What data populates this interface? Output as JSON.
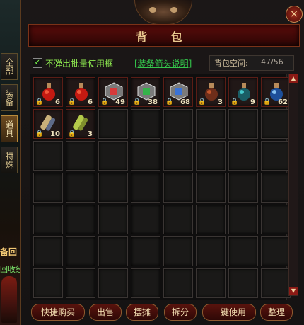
{
  "window": {
    "title": "背  包",
    "close_label": "×",
    "tabs": [
      {
        "label": "全部",
        "active": false
      },
      {
        "label": "装备",
        "active": false
      },
      {
        "label": "道具",
        "active": true
      },
      {
        "label": "特殊",
        "active": false
      }
    ]
  },
  "toolbar": {
    "checkbox_checked": true,
    "checkbox_mark": "✓",
    "checkbox_label": "不弹出批量使用框",
    "help_link": "[装备箭头说明]",
    "capacity_label": "背包空间:",
    "capacity_value": "47/56"
  },
  "inventory": {
    "items": [
      {
        "name": "red-potion-flask-icon",
        "qty": "6",
        "locked": true
      },
      {
        "name": "red-potion-flask-icon",
        "qty": "6",
        "locked": true
      },
      {
        "name": "red-gem-token-icon",
        "qty": "49",
        "locked": true
      },
      {
        "name": "green-gem-token-icon",
        "qty": "38",
        "locked": true
      },
      {
        "name": "blue-gem-token-icon",
        "qty": "68",
        "locked": true
      },
      {
        "name": "brown-vial-icon",
        "qty": "3",
        "locked": true
      },
      {
        "name": "teal-vial-icon",
        "qty": "9",
        "locked": true
      },
      {
        "name": "blue-round-potion-icon",
        "qty": "62",
        "locked": true
      },
      {
        "name": "scroll-bundle-icon",
        "qty": "10",
        "locked": true
      },
      {
        "name": "gold-scroll-icon",
        "qty": "3",
        "locked": true
      }
    ],
    "total_slots": 56
  },
  "scroll": {
    "up": "▲",
    "down": "▼"
  },
  "bottom_buttons": [
    {
      "label": "快捷购买"
    },
    {
      "label": "出售"
    },
    {
      "label": "摆摊"
    },
    {
      "label": "拆分"
    },
    {
      "label": "一键使用"
    },
    {
      "label": "整理"
    }
  ],
  "side": {
    "text1": "备回",
    "text2": "回收经"
  },
  "lock_glyph": "🔒",
  "colors": {
    "accent": "#8b1a15",
    "title_gold": "#e9c98f",
    "link_green": "#34c64b",
    "check_green": "#8de84f"
  }
}
